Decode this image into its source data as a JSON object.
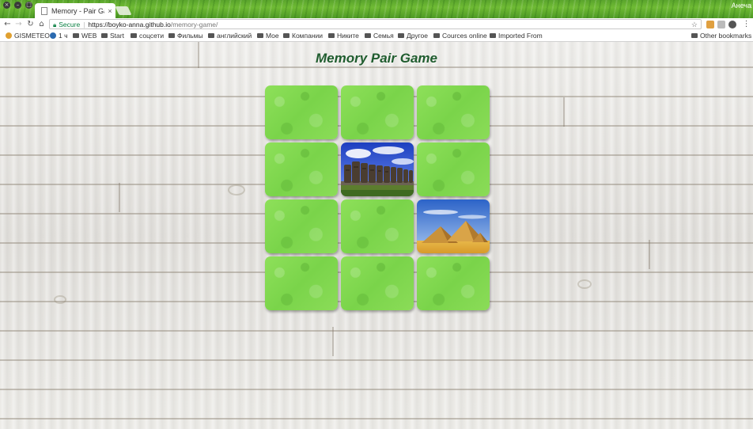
{
  "browser": {
    "tab_title": "Memory - Pair Gam",
    "tab_close": "×",
    "user_name": "Анеча",
    "address": {
      "secure_label": "Secure",
      "host": "https://boyko-anna.github.io",
      "path": "/memory-game/"
    }
  },
  "bookmarks": {
    "items": [
      {
        "label": "GISMETEO",
        "icon": "gismeteo-icon"
      },
      {
        "label": "1 ч",
        "icon": "news-icon"
      },
      {
        "label": "WEB",
        "icon": "folder-icon"
      },
      {
        "label": "Start",
        "icon": "folder-icon"
      },
      {
        "label": "соцсети",
        "icon": "folder-icon"
      },
      {
        "label": "Фильмы",
        "icon": "folder-icon"
      },
      {
        "label": "английский",
        "icon": "folder-icon"
      },
      {
        "label": "Мое",
        "icon": "folder-icon"
      },
      {
        "label": "Компании",
        "icon": "folder-icon"
      },
      {
        "label": "Никите",
        "icon": "folder-icon"
      },
      {
        "label": "Семья",
        "icon": "folder-icon"
      },
      {
        "label": "Другое",
        "icon": "folder-icon"
      },
      {
        "label": "Cources online",
        "icon": "folder-icon"
      },
      {
        "label": "Imported From",
        "icon": "folder-icon"
      }
    ],
    "other": "Other bookmarks"
  },
  "game": {
    "title": "Memory Pair Game",
    "cards": [
      {
        "state": "hidden"
      },
      {
        "state": "hidden"
      },
      {
        "state": "hidden"
      },
      {
        "state": "hidden"
      },
      {
        "state": "revealed",
        "image": "easter-island-moai"
      },
      {
        "state": "hidden"
      },
      {
        "state": "hidden"
      },
      {
        "state": "hidden"
      },
      {
        "state": "revealed",
        "image": "egypt-pyramids"
      },
      {
        "state": "hidden"
      },
      {
        "state": "hidden"
      },
      {
        "state": "hidden"
      }
    ]
  },
  "colors": {
    "card_back": "#84da52",
    "title": "#1f5c2e",
    "secure": "#0b8043"
  }
}
